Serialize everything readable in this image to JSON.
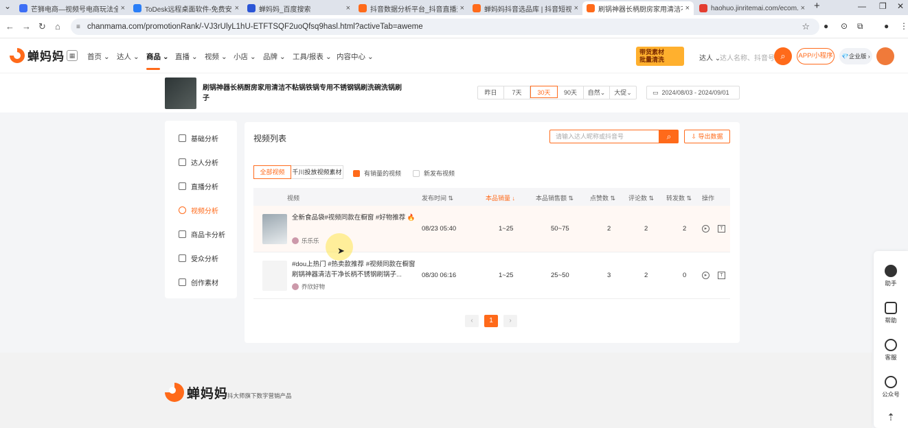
{
  "browser": {
    "tabs": [
      {
        "title": "芒狮电商—视频号电商玩法全...",
        "color": "#3d6ef5"
      },
      {
        "title": "ToDesk远程桌面软件-免费安全...",
        "color": "#2a7ef7"
      },
      {
        "title": "蝉妈妈_百度搜索",
        "color": "#2b55d6"
      },
      {
        "title": "抖音数据分析平台_抖音直播运...",
        "color": "#ff6a1a"
      },
      {
        "title": "蝉妈妈抖音选品库 | 抖音短视...",
        "color": "#ff6a1a"
      },
      {
        "title": "刷锅神器长柄厨房家用清洁不粘...",
        "color": "#ff6a1a"
      },
      {
        "title": "haohuo.jinritemai.com/ecom...",
        "color": "#e43d30"
      }
    ],
    "url": "chanmama.com/promotionRank/-VJ3rUlyL1hU-ETFTSQF2uoQfsq9hasl.html?activeTab=aweme"
  },
  "header": {
    "logo": "蝉妈妈",
    "menu": [
      "首页",
      "达人",
      "商品",
      "直播",
      "视频",
      "小店",
      "品牌",
      "工具/报表",
      "内容中心"
    ],
    "active_menu": "商品",
    "promo": [
      "带货素材",
      "批量清洗"
    ],
    "search_type": "达人",
    "search_placeholder": "达人名称、抖音号",
    "app_button": "APP/小程序",
    "enterprise_button": "企业版"
  },
  "product": {
    "title": "刷锅神器长柄厨房家用清洁不粘锅铁锅专用不锈钢锅刷洗碗洗锅刷子",
    "ranges": [
      "昨日",
      "7天",
      "30天",
      "90天",
      "自然",
      "大促"
    ],
    "active_range": "30天",
    "date_range": "2024/08/03  -  2024/09/01"
  },
  "sidebar": [
    "基础分析",
    "达人分析",
    "直播分析",
    "视频分析",
    "商品卡分析",
    "受众分析",
    "创作素材"
  ],
  "sidebar_active": "视频分析",
  "panel": {
    "title": "视频列表",
    "search_placeholder": "请输入达人昵称或抖音号",
    "export": "导出数据",
    "segments": [
      "全部视频",
      "千川投放视频素材"
    ],
    "checks": [
      {
        "label": "有销量的视频",
        "checked": true
      },
      {
        "label": "新发布视频",
        "checked": false
      }
    ],
    "columns": [
      "视频",
      "发布时间",
      "本品销量",
      "本品销售额",
      "点赞数",
      "评论数",
      "转发数",
      "操作"
    ],
    "rows": [
      {
        "title": "全新食品袋#视频同款在橱窗 #好物推荐 🔥",
        "author": "乐乐乐",
        "time": "08/23 05:40",
        "sales": "1~25",
        "amount": "50~75",
        "likes": "2",
        "comments": "2",
        "shares": "2"
      },
      {
        "title": "#dou上热门 #热卖款推荐 #视频同款在橱窗 刷锅神器清洁干净长柄不锈钢刷锅子...",
        "author": "乔欣好物",
        "time": "08/30 06:16",
        "sales": "1~25",
        "amount": "25~50",
        "likes": "3",
        "comments": "2",
        "shares": "0"
      }
    ],
    "page": "1"
  },
  "footer": {
    "logo": "蝉妈妈",
    "subtitle": "抖大师旗下数字营销产品"
  },
  "float": [
    "助手",
    "帮助",
    "客服",
    "公众号"
  ]
}
